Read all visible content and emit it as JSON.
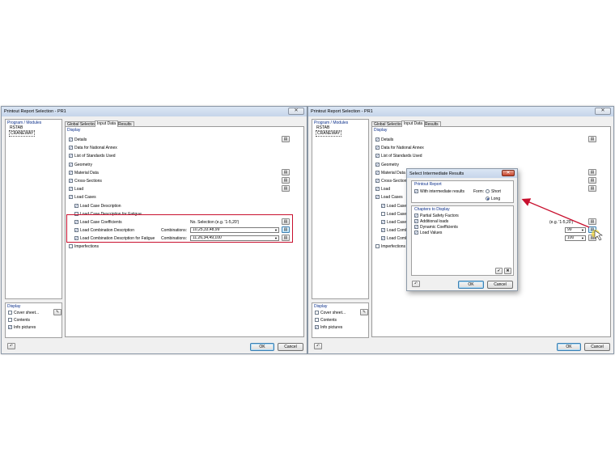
{
  "window_title": "Printout Report Selection - PR1",
  "close_glyph": "✕",
  "program_modules": {
    "header": "Program / Modules",
    "items": [
      "RSTAB",
      "CRANEWAY"
    ]
  },
  "display_panel": {
    "header": "Display",
    "items": [
      {
        "label": "Cover sheet...",
        "checked": false
      },
      {
        "label": "Contents",
        "checked": false
      },
      {
        "label": "Info pictures",
        "checked": true
      }
    ]
  },
  "tabs": [
    "Global Selection",
    "Input Data",
    "Results"
  ],
  "input_data": {
    "header": "Display",
    "items": {
      "details": "Details",
      "national_annex": "Data for National Annex",
      "standards": "List of Standards Used",
      "geometry": "Geometry",
      "material": "Material Data",
      "cross_sections": "Cross-Sections",
      "load": "Load",
      "load_cases": "Load Cases",
      "lc_description": "Load Case Description",
      "lc_description_fatigue": "Load Case Description for Fatigue",
      "lc_coefficients": "Load Case Coefficients",
      "lco_description": "Load Combination Description",
      "lco_description_fatigue": "Load Combination Description for Fatigue",
      "imperfections": "Imperfections"
    },
    "selection_hint": "No. Selection (e.g. '1-5,20')",
    "combinations_label": "Combinations:",
    "combinations_1": "10,25,33,48,99",
    "combinations_2": "11,26,34,49,100",
    "combinations_1_short": "99",
    "combinations_2_short": "100",
    "hint_short": "(e.g. '1-5,20')",
    "trunc_lc_description": "Load Case D",
    "trunc_lc_description_fatigue": "Load Case D",
    "trunc_lc_coefficients": "Load Case C",
    "trunc_lco_description": "Load Combi",
    "trunc_lco_description_fatigue": "Load Combi"
  },
  "buttons": {
    "ok": "OK",
    "cancel": "Cancel"
  },
  "dialog": {
    "title": "Select Intermediate Results",
    "printout_header": "Printout Report",
    "with_intermediate": "With intermediate results",
    "form_label": "Form:",
    "form_short": "Short",
    "form_long": "Long",
    "chapters_header": "Chapters to Display",
    "chapters": [
      "Partial Safety Factors",
      "Additional loads",
      "Dynamic Coefficients",
      "Load Values"
    ],
    "ok": "OK",
    "cancel": "Cancel"
  },
  "colors": {
    "highlight": "#c8102e",
    "arrow": "#c8102e",
    "group_header": "#0a2e8a"
  }
}
